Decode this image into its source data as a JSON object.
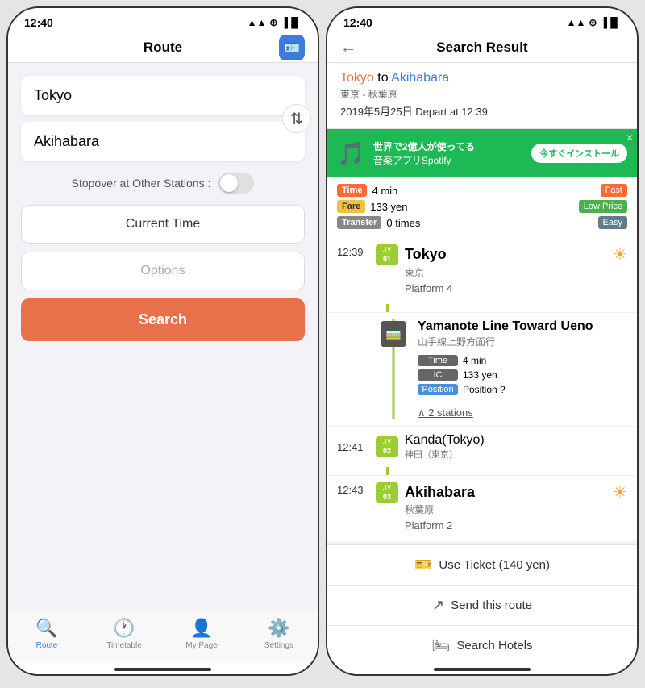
{
  "left_phone": {
    "status": {
      "time": "12:40",
      "icons": "▲▲ ⊕ ▐▐"
    },
    "nav": {
      "title": "Route",
      "icon": "🪪"
    },
    "form": {
      "from_placeholder": "Tokyo",
      "to_placeholder": "Akihabara",
      "stopover_label": "Stopover at Other Stations :",
      "time_btn": "Current Time",
      "options_btn": "Options",
      "search_btn": "Search"
    },
    "tabs": [
      {
        "label": "Route",
        "icon": "🔍",
        "active": true
      },
      {
        "label": "Timetable",
        "icon": "🕐",
        "active": false
      },
      {
        "label": "My Page",
        "icon": "👤",
        "active": false
      },
      {
        "label": "Settings",
        "icon": "⚙️",
        "active": false
      }
    ]
  },
  "right_phone": {
    "status": {
      "time": "12:40"
    },
    "nav": {
      "title": "Search Result",
      "back": "←"
    },
    "route_header": {
      "from": "Tokyo",
      "to": "Akihabara",
      "from_jp": "東京",
      "to_jp": "秋葉原",
      "separator": " to ",
      "subtitle": "東京 - 秋葉原",
      "date": "2019年5月25日 Depart at 12:39"
    },
    "ad": {
      "text1": "世界で2億人が使ってる",
      "text2": "音楽アプリSpotify",
      "btn": "今すぐインストール"
    },
    "summary": {
      "time_label": "Time",
      "time_val": "4 min",
      "fare_label": "Fare",
      "fare_val": "133 yen",
      "transfer_label": "Transfer",
      "transfer_val": "0 times",
      "badge_fast": "Fast",
      "badge_lowprice": "Low Price",
      "badge_easy": "Easy"
    },
    "timeline": [
      {
        "time": "12:39",
        "badge_line": "JY",
        "badge_num": "01",
        "name": "Tokyo",
        "name_jp": "東京",
        "platform": "Platform 4",
        "has_sun": true
      }
    ],
    "train": {
      "name": "Yamanote Line Toward Ueno",
      "name_jp": "山手線上野方面行",
      "time_label": "Time",
      "time_val": "4 min",
      "ic_label": "IC",
      "ic_val": "133 yen",
      "pos_label": "Position",
      "pos_val": "Position ?",
      "stations_link": "∧ 2 stations"
    },
    "intermediate": {
      "time": "12:41",
      "badge_line": "JY",
      "badge_num": "02",
      "name": "Kanda(Tokyo)",
      "name_jp": "神田（東京）"
    },
    "destination": {
      "time": "12:43",
      "badge_line": "JY",
      "badge_num": "03",
      "name": "Akihabara",
      "name_jp": "秋葉原",
      "platform": "Platform 2",
      "has_sun": true
    },
    "actions": [
      {
        "icon": "🎫",
        "label": "Use Ticket (140 yen)"
      },
      {
        "icon": "↗",
        "label": "Send this route"
      },
      {
        "icon": "🛏",
        "label": "Search Hotels"
      }
    ]
  }
}
